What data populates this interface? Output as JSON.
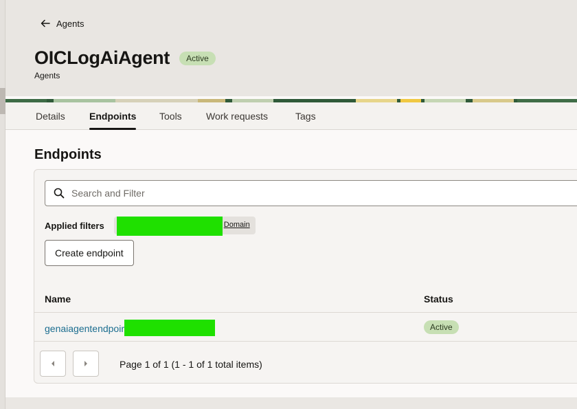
{
  "header": {
    "back_label": "Agents",
    "title": "OICLogAiAgent",
    "status": "Active",
    "subtitle": "Agents"
  },
  "tabs": [
    {
      "label": "Details",
      "selected": false
    },
    {
      "label": "Endpoints",
      "selected": true
    },
    {
      "label": "Tools",
      "selected": false
    },
    {
      "label": "Work requests",
      "selected": false
    },
    {
      "label": "Tags",
      "selected": false
    }
  ],
  "section": {
    "title": "Endpoints"
  },
  "search": {
    "placeholder": "Search and Filter",
    "value": ""
  },
  "filters": {
    "label": "Applied filters",
    "chip_text": "Domain"
  },
  "actions": {
    "create_label": "Create endpoint"
  },
  "table": {
    "columns": [
      "Name",
      "Status"
    ],
    "rows": [
      {
        "name": "genaiagentendpoir",
        "status": "Active"
      }
    ]
  },
  "pagination": {
    "text": "Page 1 of 1 (1 - 1 of 1 total items)"
  },
  "colors": {
    "accent_link": "#1b6d8f",
    "active_badge": "#c7dfb4",
    "redaction": "#1fe000"
  }
}
